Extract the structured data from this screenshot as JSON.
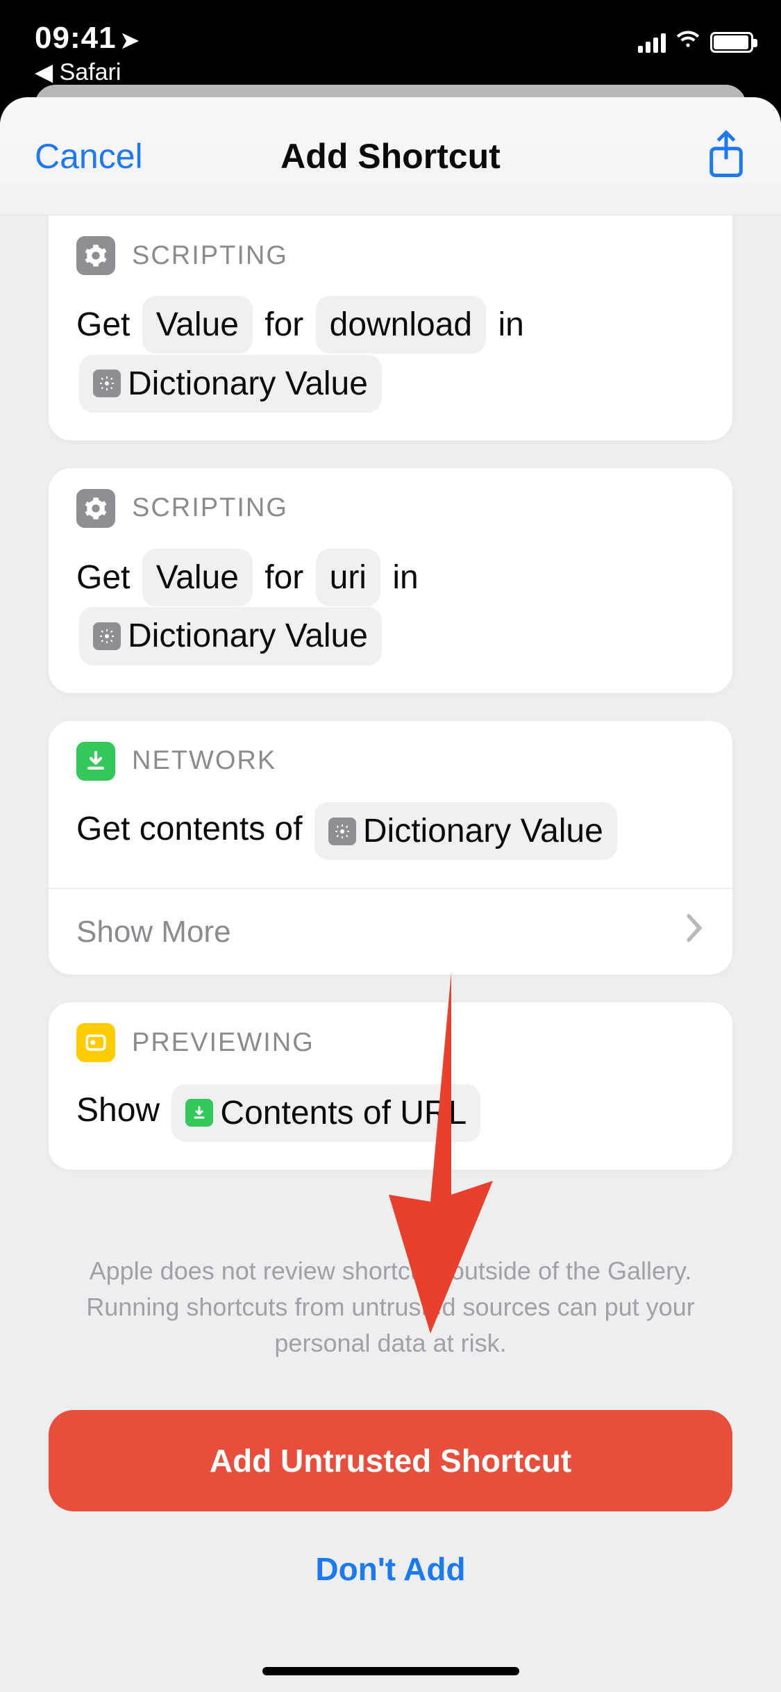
{
  "status": {
    "time": "09:41",
    "back_app": "Safari"
  },
  "sheet": {
    "cancel": "Cancel",
    "title": "Add Shortcut"
  },
  "actions": [
    {
      "category": "SCRIPTING",
      "parts": {
        "p1": "Get",
        "t1": "Value",
        "p2": "for",
        "t2": "download",
        "p3": "in",
        "t3": "Dictionary Value"
      }
    },
    {
      "category": "SCRIPTING",
      "parts": {
        "p1": "Get",
        "t1": "Value",
        "p2": "for",
        "t2": "uri",
        "p3": "in",
        "t3": "Dictionary Value"
      }
    },
    {
      "category": "NETWORK",
      "parts": {
        "p1": "Get contents of",
        "t1": "Dictionary Value"
      },
      "show_more": "Show More"
    },
    {
      "category": "PREVIEWING",
      "parts": {
        "p1": "Show",
        "t1": "Contents of URL"
      }
    }
  ],
  "warning_text": "Apple does not review shortcuts outside of the Gallery. Running shortcuts from untrusted sources can put your personal data at risk.",
  "buttons": {
    "add": "Add Untrusted Shortcut",
    "dont": "Don't Add"
  },
  "colors": {
    "accent_blue": "#1d79f2",
    "danger_red": "#e74e3c",
    "green": "#34c759",
    "yellow": "#ffcc02",
    "gray": "#8e8e93"
  }
}
